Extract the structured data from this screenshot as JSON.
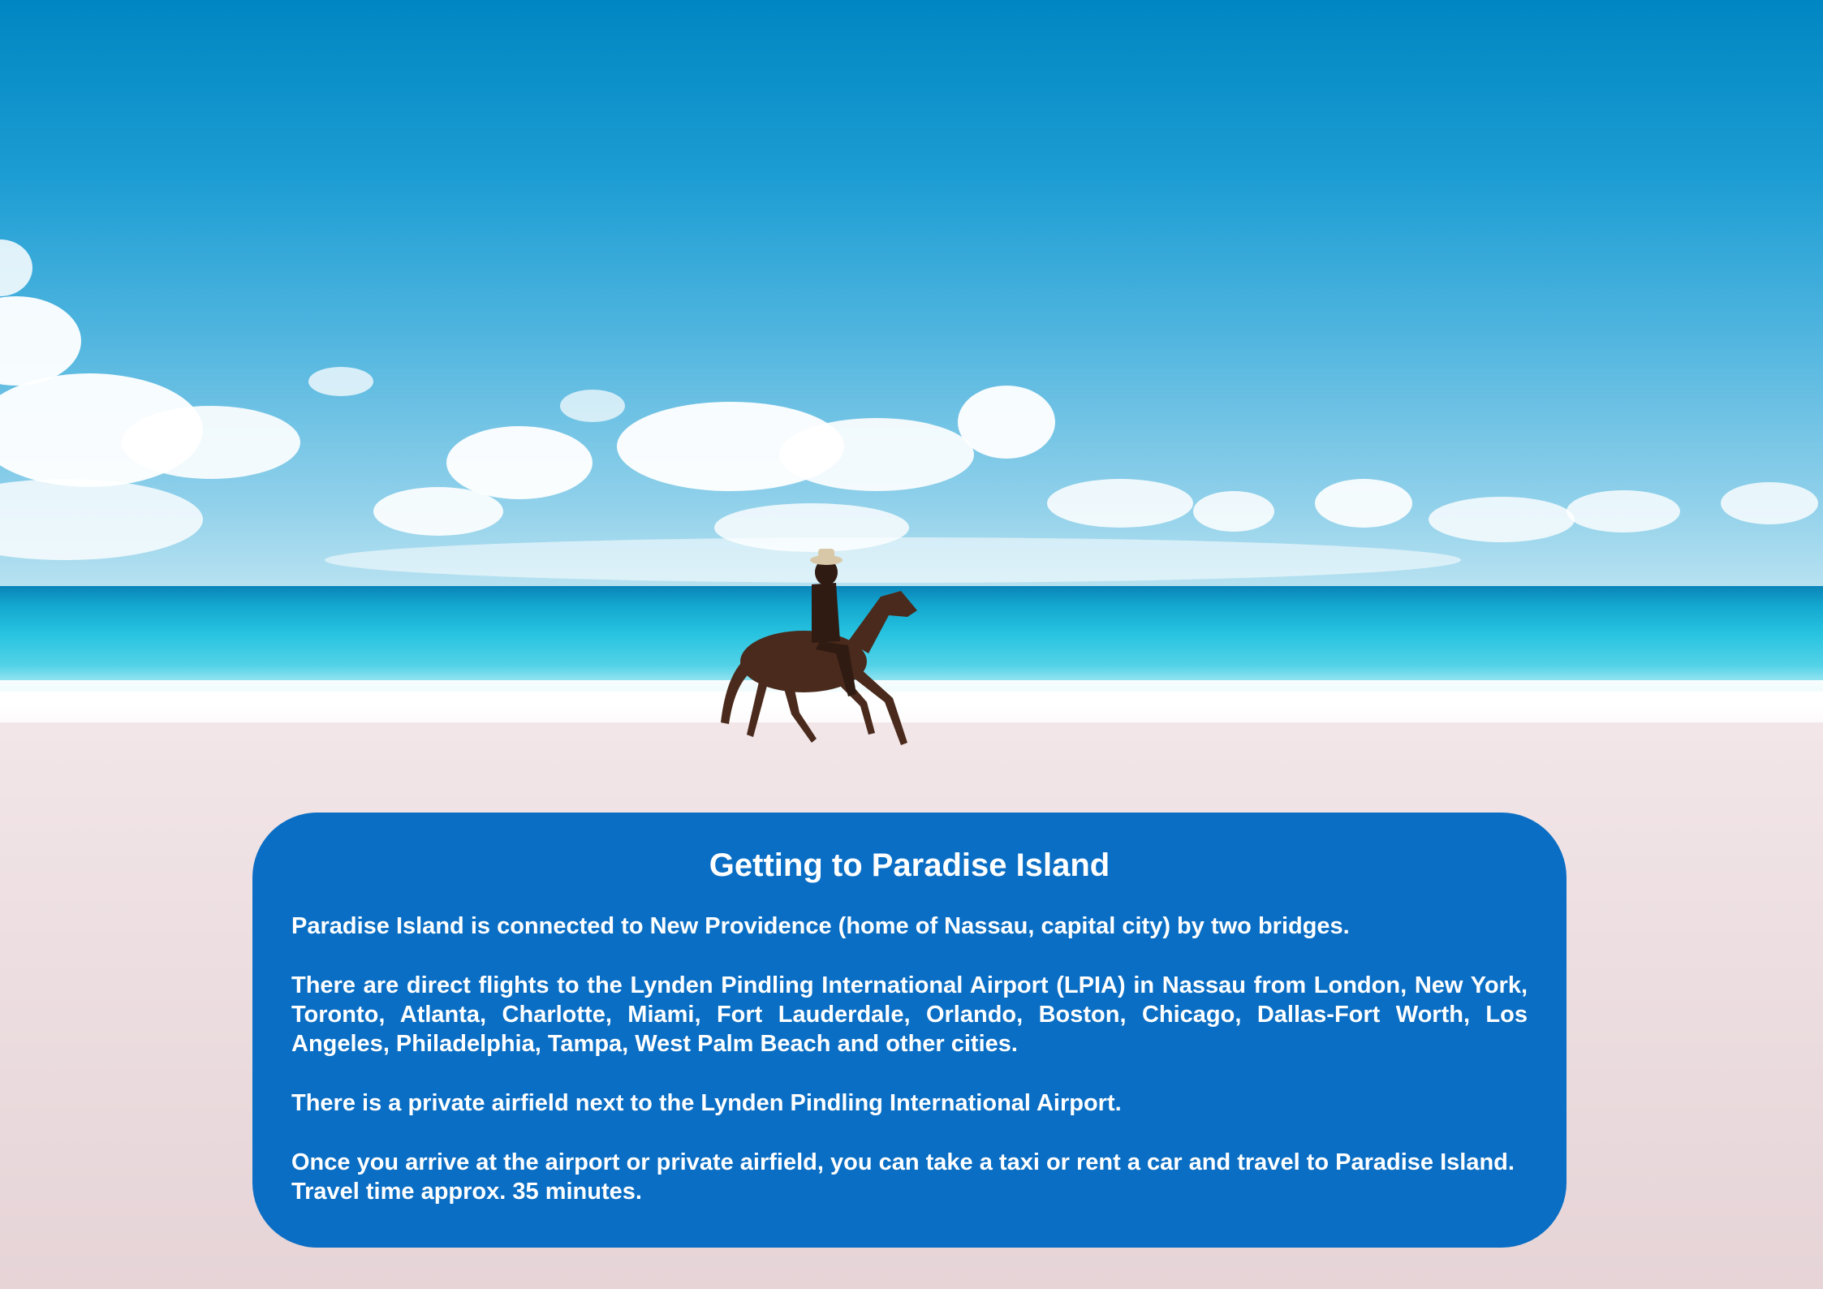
{
  "info_panel": {
    "title": "Getting to Paradise Island",
    "paragraphs": [
      "Paradise Island is connected to New Providence (home of Nassau, capital city) by two bridges.",
      "There are direct flights to the Lynden Pindling International Airport (LPIA) in Nassau from London, New York, Toronto, Atlanta, Charlotte, Miami, Fort Lauderdale, Orlando, Boston, Chicago, Dallas-Fort Worth, Los Angeles, Philadelphia, Tampa, West Palm Beach and other cities.",
      "There is a private airfield next to the Lynden Pindling International Airport.",
      "Once you arrive at the airport or private airfield, you can take a taxi or rent a car and travel to Paradise Island.  Travel time approx. 35 minutes."
    ]
  },
  "colors": {
    "panel_background": "#0a6ec4",
    "panel_text": "#ffffff",
    "sky_top": "#0086c2",
    "sea": "#27c3e0",
    "sand": "#eddfe2"
  }
}
